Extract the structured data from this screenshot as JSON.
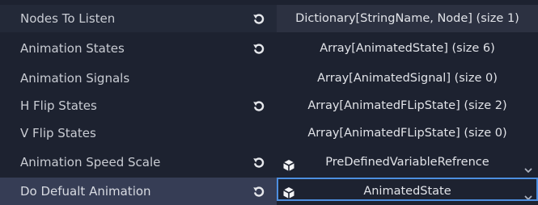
{
  "colors": {
    "background": "#1d2230",
    "row_alt": "#232938",
    "row_highlight": "#363d55",
    "selected_border": "#4d8fe0",
    "text": "#c9ccd3",
    "value_text": "#e1e3e8"
  },
  "properties": [
    {
      "label": "Nodes To Listen",
      "has_revert": true,
      "value": "Dictionary[StringName, Node] (size 1)"
    },
    {
      "label": "Animation States",
      "has_revert": true,
      "value": "Array[AnimatedState] (size 6)"
    },
    {
      "label": "Animation Signals",
      "has_revert": false,
      "value": "Array[AnimatedSignal] (size 0)"
    },
    {
      "label": "H Flip States",
      "has_revert": true,
      "value": "Array[AnimatedFLipState] (size 2)"
    },
    {
      "label": "V Flip States",
      "has_revert": false,
      "value": "Array[AnimatedFLipState] (size 0)"
    },
    {
      "label": "Animation Speed Scale",
      "has_revert": true,
      "value": "PreDefinedVariableRefrence",
      "resource_icon": "cube-icon",
      "dropdown_icon": "chevron-down-icon"
    },
    {
      "label": "Do Defualt Animation",
      "has_revert": true,
      "value": "AnimatedState",
      "resource_icon": "cube-icon",
      "dropdown_icon": "chevron-down-icon",
      "selected": true
    }
  ],
  "icons": {
    "revert": "revert-icon"
  }
}
